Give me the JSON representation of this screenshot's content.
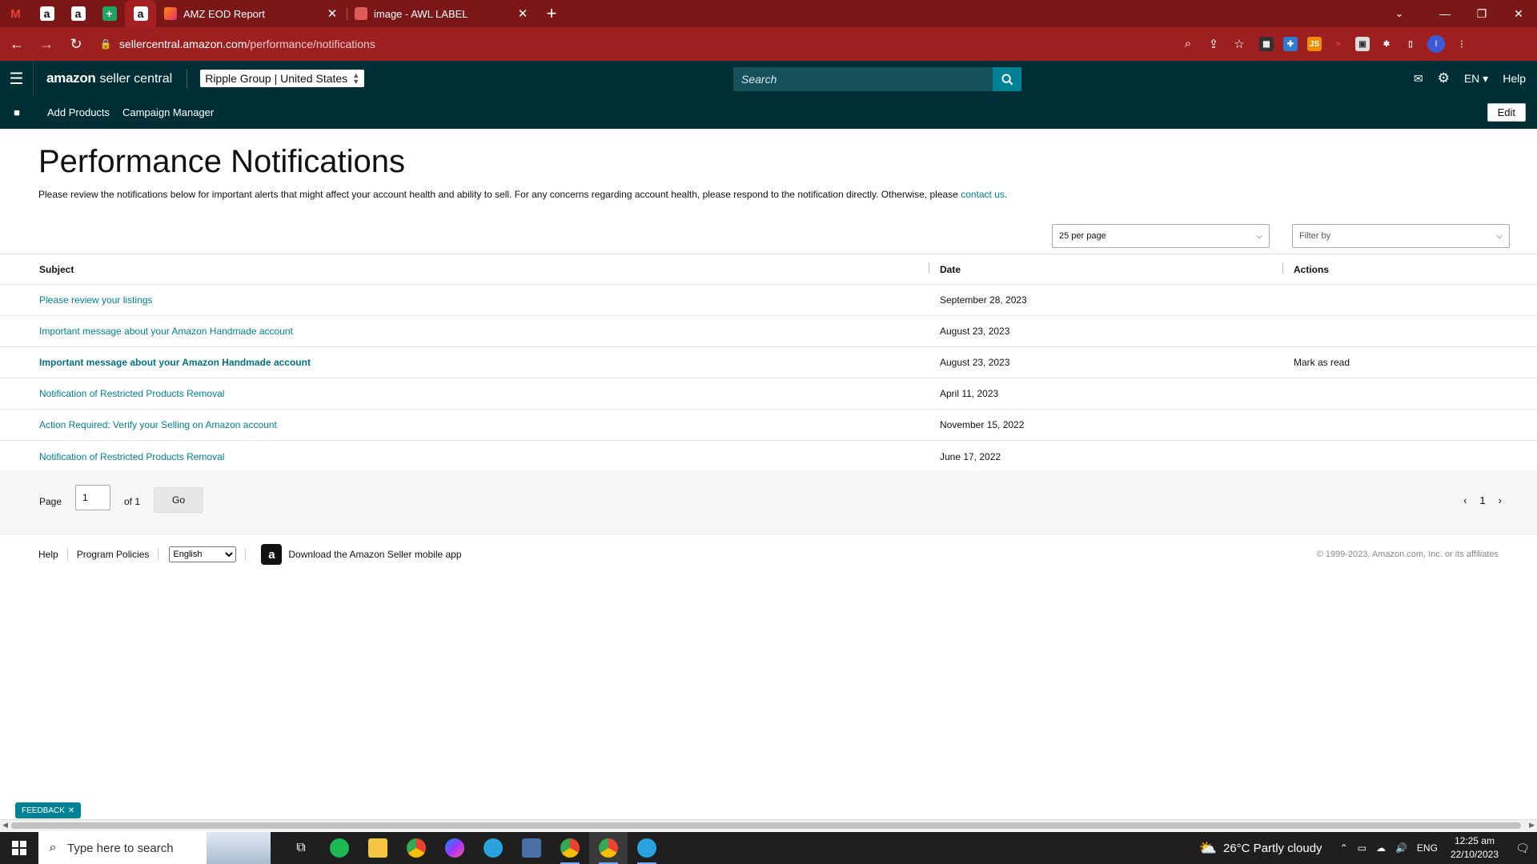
{
  "browser": {
    "tabs": [
      {
        "title": "AMZ EOD Report",
        "favicon": "google-sheets-icon"
      },
      {
        "title": "image - AWL LABEL",
        "favicon": "label-icon"
      }
    ],
    "url_host": "sellercentral.amazon.com",
    "url_path": "/performance/notifications"
  },
  "header": {
    "logo_brand": "amazon",
    "logo_product": "seller central",
    "account": "Ripple Group",
    "marketplace": "United States",
    "search_placeholder": "Search",
    "language": "EN",
    "help": "Help"
  },
  "bookmarks": {
    "items": [
      "Add Products",
      "Campaign Manager"
    ],
    "edit": "Edit"
  },
  "page": {
    "title": "Performance Notifications",
    "intro": "Please review the notifications below for important alerts that might affect your account health and ability to sell. For any concerns regarding account health, please respond to the notification directly. Otherwise, please ",
    "contact_link": "contact us.",
    "per_page": "25 per page",
    "filter": "Filter by"
  },
  "table": {
    "headers": [
      "Subject",
      "Date",
      "Actions"
    ],
    "rows": [
      {
        "subject": "Please review your listings",
        "date": "September 28, 2023",
        "action": ""
      },
      {
        "subject": "Important message about your Amazon Handmade account",
        "date": "August 23, 2023",
        "action": ""
      },
      {
        "subject": "Important message about your Amazon Handmade account",
        "date": "August 23, 2023",
        "action": "Mark as read"
      },
      {
        "subject": "Notification of Restricted Products Removal",
        "date": "April 11, 2023",
        "action": ""
      },
      {
        "subject": "Action Required: Verify your Selling on Amazon account",
        "date": "November 15, 2022",
        "action": ""
      },
      {
        "subject": "Notification of Restricted Products Removal",
        "date": "June 17, 2022",
        "action": ""
      }
    ]
  },
  "pager": {
    "page_label": "Page",
    "current": "1",
    "of_label": "of 1",
    "go": "Go",
    "page_number": "1"
  },
  "footer": {
    "help": "Help",
    "policies": "Program Policies",
    "language": "English",
    "app_text": "Download the Amazon Seller mobile app",
    "copyright": "© 1999-2023, Amazon.com, Inc. or its affiliates"
  },
  "feedback": "FEEDBACK",
  "taskbar": {
    "search_placeholder": "Type here to search",
    "weather": "26°C  Partly cloudy",
    "lang": "ENG",
    "time": "12:25 am",
    "date": "22/10/2023"
  },
  "colors": {
    "chrome_frame": "#7b1717",
    "chrome_toolbar": "#9d1f1f",
    "seller_header": "#002f36",
    "link": "#008296"
  }
}
